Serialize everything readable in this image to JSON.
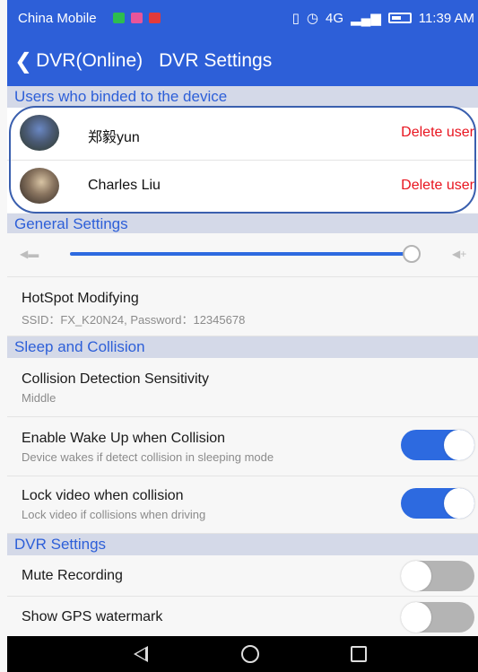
{
  "status_bar": {
    "carrier": "China Mobile",
    "network": "4G",
    "time": "11:39 AM",
    "icons": [
      "notification-icon-1",
      "notification-icon-2",
      "notification-icon-3",
      "vibrate-icon",
      "alarm-icon",
      "signal-icon",
      "battery-icon"
    ]
  },
  "header": {
    "back_icon": "chevron-left-icon",
    "device_name": "DVR(Online)",
    "title": "DVR Settings"
  },
  "sections": {
    "users": "Users who binded to the device",
    "general": "General Settings",
    "sleep": "Sleep and Collision",
    "dvr": "DVR Settings"
  },
  "users": [
    {
      "name": "郑毅yun",
      "action": "Delete user"
    },
    {
      "name": "Charles Liu",
      "action": "Delete user"
    }
  ],
  "volume": {
    "level": 0.93,
    "min_icon": "volume-down-icon",
    "max_icon": "volume-up-icon"
  },
  "hotspot": {
    "label": "HotSpot Modifying",
    "detail": "SSID：FX_K20N24, Password：12345678"
  },
  "collision_sensitivity": {
    "label": "Collision Detection Sensitivity",
    "value": "Middle"
  },
  "wake_up": {
    "label": "Enable Wake Up when Collision",
    "detail": "Device wakes if detect collision in sleeping mode",
    "enabled": true
  },
  "lock_video": {
    "label": "Lock video when collision",
    "detail": "Lock video if collisions when driving",
    "enabled": true
  },
  "mute_recording": {
    "label": "Mute Recording",
    "enabled": false
  },
  "gps_watermark": {
    "label": "Show GPS watermark",
    "enabled": false
  },
  "colors": {
    "accent": "#2d5fd8",
    "delete": "#e8141f",
    "toggle_off": "#b4b4b4"
  }
}
